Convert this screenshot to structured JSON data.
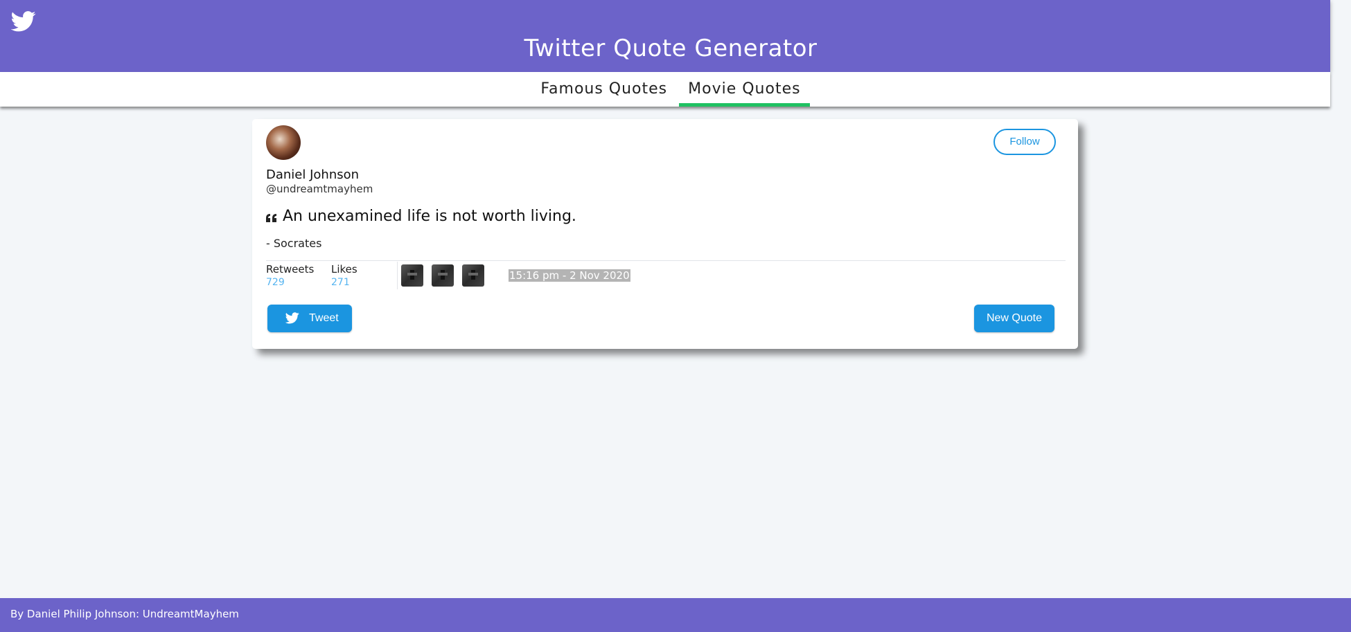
{
  "header": {
    "title": "Twitter Quote Generator",
    "logo_icon": "twitter-bird-icon"
  },
  "nav": {
    "tabs": [
      {
        "label": "Famous Quotes",
        "active": false
      },
      {
        "label": "Movie Quotes",
        "active": true
      }
    ],
    "active_color": "#1fc162"
  },
  "card": {
    "avatar": "avatar-image",
    "follow_label": "Follow",
    "user_name": "Daniel Johnson",
    "user_handle": "@undreamtmayhem",
    "quote_icon": "quote-left-icon",
    "quote": "An unexamined life is not worth living.",
    "author": "- Socrates",
    "stats": [
      {
        "label": "Retweets",
        "value": "729"
      },
      {
        "label": "Likes",
        "value": "271"
      }
    ],
    "thumbnails": 3,
    "timestamp": "15:16 pm - 2 Nov 2020",
    "tweet_label": "Tweet",
    "tweet_icon": "twitter-bird-icon",
    "new_quote_label": "New Quote"
  },
  "footer": {
    "text": "By Daniel Philip Johnson: UndreamtMayhem"
  },
  "colors": {
    "brand": "#6c63c9",
    "button": "#1b95e0",
    "stat_value": "#55b4f0",
    "background": "#f3f6f9"
  }
}
